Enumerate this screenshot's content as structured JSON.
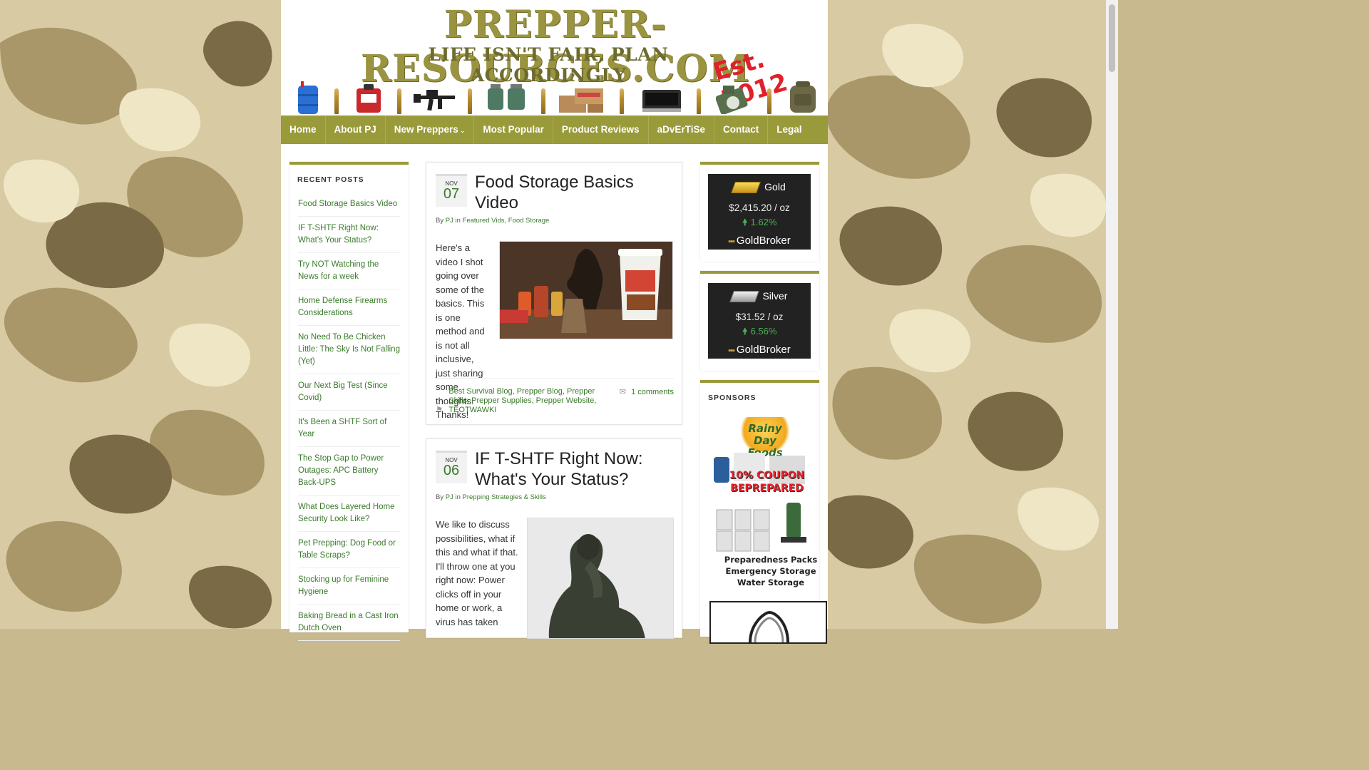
{
  "brand": {
    "title": "PREPPER-RESOURCES.COM",
    "tagline": "LIFE ISN'T FAIR, PLAN ACCORDINGLY",
    "est": "Est. 2012"
  },
  "nav": {
    "items": [
      "Home",
      "About PJ",
      "New Preppers",
      "Most Popular",
      "Product Reviews",
      "aDvErTiSe",
      "Contact",
      "Legal"
    ]
  },
  "sidebar_left": {
    "title": "RECENT POSTS",
    "items": [
      "Food Storage Basics Video",
      "IF T-SHTF Right Now: What's Your Status?",
      "Try NOT Watching the News for a week",
      "Home Defense Firearms Considerations",
      "No Need To Be Chicken Little: The Sky Is Not Falling (Yet)",
      "Our Next Big Test (Since Covid)",
      "It's Been a SHTF Sort of Year",
      "The Stop Gap to Power Outages: APC Battery Back-UPS",
      "What Does Layered Home Security Look Like?",
      "Pet Prepping: Dog Food or Table Scraps?",
      "Stocking up for Feminine Hygiene",
      "Baking Bread in a Cast Iron Dutch Oven"
    ]
  },
  "posts": [
    {
      "month": "NOV",
      "day": "07",
      "title": "Food Storage Basics Video",
      "meta_by": "By",
      "author": "PJ",
      "meta_in": "in",
      "categories": "Featured Vids, Food Storage",
      "body": "Here's a video I shot going over some of the basics.  This is one method and is not all inclusive, just sharing some thoughts.  Thanks!",
      "tags": "Best Survival Blog, Prepper Blog, Prepper Skills, Prepper Supplies, Prepper Website, TEOTWAWKI",
      "comments": "1 comments"
    },
    {
      "month": "NOV",
      "day": "06",
      "title": "IF T-SHTF Right Now: What's Your Status?",
      "meta_by": "By",
      "author": "PJ",
      "meta_in": "in",
      "categories": "Prepping Strategies & Skills",
      "body": "We like to discuss possibilities, what if this and what if that.  I'll throw one at you right now: Power clicks off in your home or work, a virus has taken"
    }
  ],
  "metals": [
    {
      "name": "Gold",
      "price": "$2,415.20 / oz",
      "change": "1.62%",
      "brand": "GoldBroker",
      "color": "#e6b820"
    },
    {
      "name": "Silver",
      "price": "$31.52 / oz",
      "change": "6.56%",
      "brand": "GoldBroker",
      "color": "#c9c9c9"
    }
  ],
  "sponsors": {
    "title": "SPONSORS",
    "ad_brand": "Rainy Day Foods",
    "ad_coupon_1": "10% COUPON",
    "ad_coupon_2": "BEPREPARED",
    "ad_line_1": "Preparedness Packs",
    "ad_line_2": "Emergency Storage",
    "ad_line_3": "Water Storage"
  },
  "colors": {
    "accent": "#999a3a",
    "link": "#3a7b2a",
    "up": "#4caf50"
  }
}
